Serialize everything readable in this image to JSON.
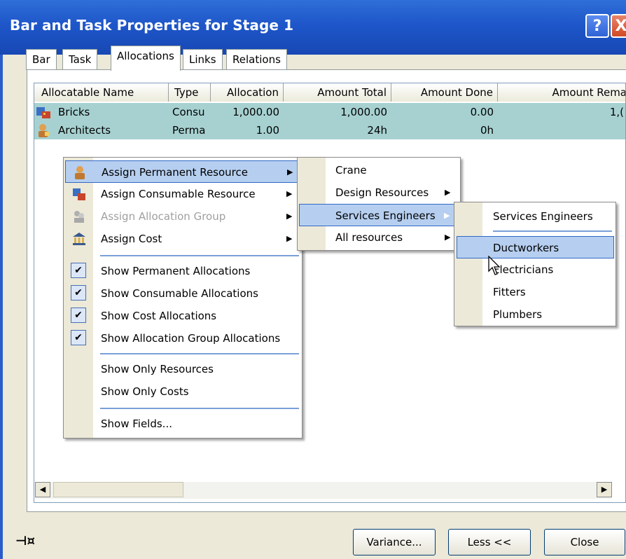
{
  "window": {
    "title": "Bar and Task Properties for Stage 1",
    "help_glyph": "?",
    "close_glyph": "X"
  },
  "tabs": [
    "Bar",
    "Task",
    "Allocations",
    "Links",
    "Relations"
  ],
  "active_tab": "Allocations",
  "table": {
    "columns": [
      "Allocatable Name",
      "Type",
      "Allocation",
      "Amount Total",
      "Amount Done",
      "Amount Rema"
    ],
    "rows": [
      {
        "name": "Bricks",
        "type": "Consu",
        "allocation": "1,000.00",
        "amount_total": "1,000.00",
        "amount_done": "0.00",
        "amount_remaining": "1,("
      },
      {
        "name": "Architects",
        "type": "Perma",
        "allocation": "1.00",
        "amount_total": "24h",
        "amount_done": "0h",
        "amount_remaining": ""
      }
    ]
  },
  "context_menu": {
    "items": [
      {
        "label": "Assign Permanent Resource",
        "icon": "person-icon",
        "submenu": true,
        "selected": true
      },
      {
        "label": "Assign Consumable Resource",
        "icon": "consumable-icon",
        "submenu": true
      },
      {
        "label": "Assign Allocation Group",
        "icon": "group-icon",
        "submenu": true,
        "disabled": true
      },
      {
        "label": "Assign Cost",
        "icon": "bank-icon",
        "submenu": true
      },
      {
        "label": "Show Permanent Allocations",
        "checked": true
      },
      {
        "label": "Show Consumable Allocations",
        "checked": true
      },
      {
        "label": "Show Cost Allocations",
        "checked": true
      },
      {
        "label": "Show Allocation Group Allocations",
        "checked": true
      },
      {
        "label": "Show Only Resources"
      },
      {
        "label": "Show Only Costs"
      },
      {
        "label": "Show Fields..."
      }
    ]
  },
  "submenu1": {
    "items": [
      "Crane",
      "Design Resources",
      "Services Engineers",
      "All resources"
    ],
    "selected": "Services Engineers"
  },
  "submenu2": {
    "items": [
      "Services Engineers",
      "Ductworkers",
      "Electricians",
      "Fitters",
      "Plumbers"
    ],
    "selected": "Ductworkers"
  },
  "footer": {
    "variance_label": "Variance...",
    "less_label": "Less <<",
    "close_label": "Close",
    "pin_glyph": "⊣¤"
  },
  "colors": {
    "titlebar": "#1e56c9",
    "row_highlight": "#a7d1d1",
    "menu_selection": "#b6cff0",
    "dialog_bg": "#ece9d8"
  }
}
